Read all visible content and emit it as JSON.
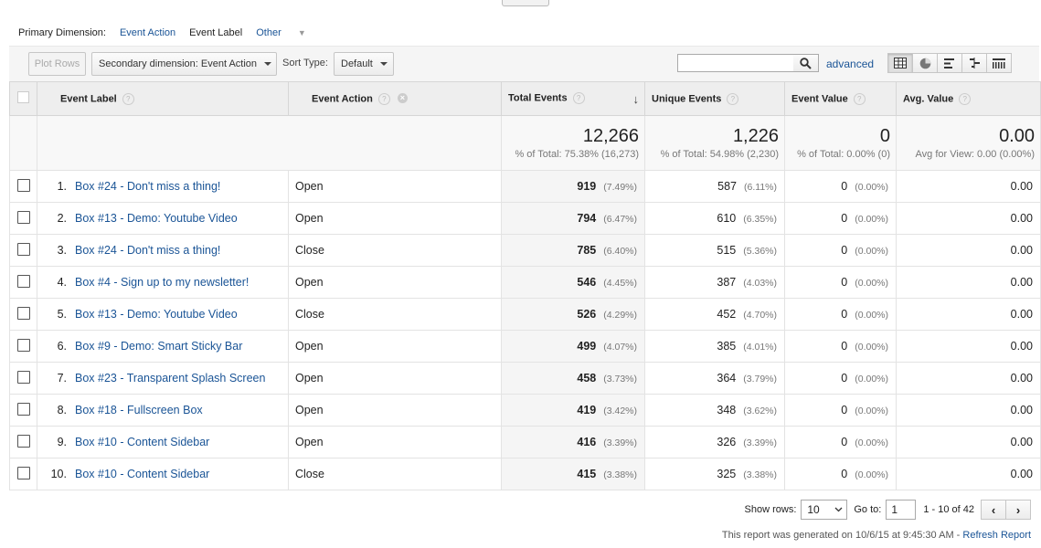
{
  "dimension_bar": {
    "primary_label": "Primary Dimension:",
    "options": [
      "Event Action",
      "Event Label"
    ],
    "active": "Event Label",
    "other": "Other"
  },
  "toolbar": {
    "plot_rows": "Plot Rows",
    "secondary_dimension": "Secondary dimension: Event Action",
    "sort_type_label": "Sort Type:",
    "sort_type_value": "Default",
    "search_value": "",
    "advanced": "advanced",
    "view_icons": [
      "table-view-icon",
      "pie-view-icon",
      "performance-view-icon",
      "comparison-view-icon",
      "pivot-view-icon"
    ]
  },
  "table": {
    "headers": {
      "label": "Event Label",
      "action": "Event Action",
      "total": "Total Events",
      "unique": "Unique Events",
      "value": "Event Value",
      "avg": "Avg. Value"
    },
    "totals": {
      "total": "12,266",
      "total_sub": "% of Total: 75.38% (16,273)",
      "unique": "1,226",
      "unique_sub": "% of Total: 54.98% (2,230)",
      "value": "0",
      "value_sub": "% of Total: 0.00% (0)",
      "avg": "0.00",
      "avg_sub": "Avg for View: 0.00 (0.00%)"
    },
    "rows": [
      {
        "num": "1.",
        "label": "Box #24 - Don't miss a thing!",
        "action": "Open",
        "total": "919",
        "total_pct": "(7.49%)",
        "unique": "587",
        "unique_pct": "(6.11%)",
        "value": "0",
        "value_pct": "(0.00%)",
        "avg": "0.00"
      },
      {
        "num": "2.",
        "label": "Box #13 - Demo: Youtube Video",
        "action": "Open",
        "total": "794",
        "total_pct": "(6.47%)",
        "unique": "610",
        "unique_pct": "(6.35%)",
        "value": "0",
        "value_pct": "(0.00%)",
        "avg": "0.00"
      },
      {
        "num": "3.",
        "label": "Box #24 - Don't miss a thing!",
        "action": "Close",
        "total": "785",
        "total_pct": "(6.40%)",
        "unique": "515",
        "unique_pct": "(5.36%)",
        "value": "0",
        "value_pct": "(0.00%)",
        "avg": "0.00"
      },
      {
        "num": "4.",
        "label": "Box #4 - Sign up to my newsletter!",
        "action": "Open",
        "total": "546",
        "total_pct": "(4.45%)",
        "unique": "387",
        "unique_pct": "(4.03%)",
        "value": "0",
        "value_pct": "(0.00%)",
        "avg": "0.00"
      },
      {
        "num": "5.",
        "label": "Box #13 - Demo: Youtube Video",
        "action": "Close",
        "total": "526",
        "total_pct": "(4.29%)",
        "unique": "452",
        "unique_pct": "(4.70%)",
        "value": "0",
        "value_pct": "(0.00%)",
        "avg": "0.00"
      },
      {
        "num": "6.",
        "label": "Box #9 - Demo: Smart Sticky Bar",
        "action": "Open",
        "total": "499",
        "total_pct": "(4.07%)",
        "unique": "385",
        "unique_pct": "(4.01%)",
        "value": "0",
        "value_pct": "(0.00%)",
        "avg": "0.00"
      },
      {
        "num": "7.",
        "label": "Box #23 - Transparent Splash Screen",
        "action": "Open",
        "total": "458",
        "total_pct": "(3.73%)",
        "unique": "364",
        "unique_pct": "(3.79%)",
        "value": "0",
        "value_pct": "(0.00%)",
        "avg": "0.00"
      },
      {
        "num": "8.",
        "label": "Box #18 - Fullscreen Box",
        "action": "Open",
        "total": "419",
        "total_pct": "(3.42%)",
        "unique": "348",
        "unique_pct": "(3.62%)",
        "value": "0",
        "value_pct": "(0.00%)",
        "avg": "0.00"
      },
      {
        "num": "9.",
        "label": "Box #10 - Content Sidebar",
        "action": "Open",
        "total": "416",
        "total_pct": "(3.39%)",
        "unique": "326",
        "unique_pct": "(3.39%)",
        "value": "0",
        "value_pct": "(0.00%)",
        "avg": "0.00"
      },
      {
        "num": "10.",
        "label": "Box #10 - Content Sidebar",
        "action": "Close",
        "total": "415",
        "total_pct": "(3.38%)",
        "unique": "325",
        "unique_pct": "(3.38%)",
        "value": "0",
        "value_pct": "(0.00%)",
        "avg": "0.00"
      }
    ]
  },
  "pager": {
    "show_rows_label": "Show rows:",
    "show_rows_value": "10",
    "goto_label": "Go to:",
    "goto_value": "1",
    "range": "1 - 10 of 42"
  },
  "footer": {
    "generated": "This report was generated on 10/6/15 at 9:45:30 AM -",
    "refresh": "Refresh Report"
  },
  "colors": {
    "link": "#1a5496",
    "header_bg": "#eeeeee",
    "toolbar_bg": "#f5f5f5"
  }
}
